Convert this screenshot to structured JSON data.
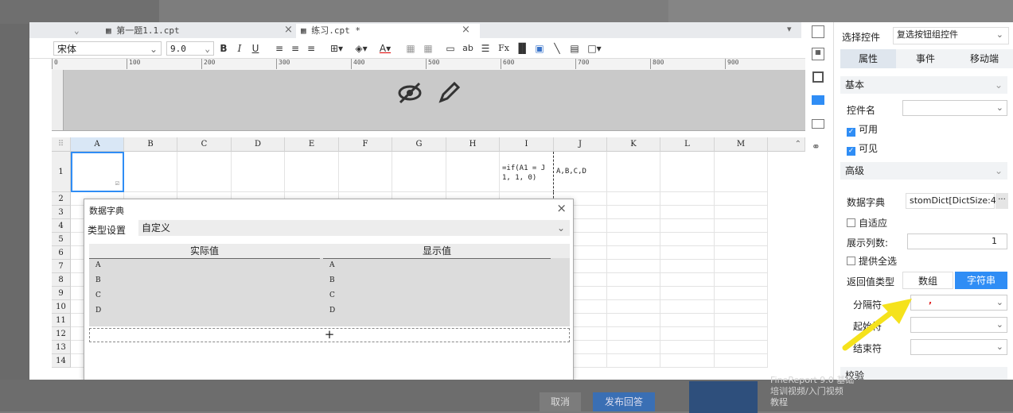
{
  "tabs": [
    {
      "label": "第一题1.1.cpt",
      "active": false
    },
    {
      "label": "练习.cpt *",
      "active": true
    }
  ],
  "format_bar": {
    "font": "宋体",
    "size": "9.0",
    "bold": "B",
    "italic": "I",
    "underline": "U"
  },
  "ruler_ticks": [
    "0",
    "100",
    "200",
    "300",
    "400",
    "500",
    "600",
    "700",
    "800",
    "900"
  ],
  "columns": [
    "A",
    "B",
    "C",
    "D",
    "E",
    "F",
    "G",
    "H",
    "I",
    "J",
    "K",
    "L",
    "M"
  ],
  "rows": [
    "1",
    "2",
    "3",
    "4",
    "5",
    "6",
    "7",
    "8",
    "9",
    "10",
    "11",
    "12",
    "13",
    "14"
  ],
  "cells": {
    "I1_line1": "=if(A1 = J",
    "I1_line2": "1, 1, 0)",
    "J1": "A,B,C,D"
  },
  "dialog": {
    "title": "数据字典",
    "type_label": "类型设置",
    "type_value": "自定义",
    "col_actual": "实际值",
    "col_display": "显示值",
    "rows": [
      {
        "actual": "A",
        "display": "A"
      },
      {
        "actual": "B",
        "display": "B"
      },
      {
        "actual": "C",
        "display": "C"
      },
      {
        "actual": "D",
        "display": "D"
      }
    ],
    "add_symbol": "+"
  },
  "panel": {
    "select_control_label": "选择控件",
    "select_control_value": "复选按钮组控件",
    "tabs": [
      "属性",
      "事件",
      "移动端"
    ],
    "section_basic": "基本",
    "control_name_label": "控件名",
    "enabled": "可用",
    "visible": "可见",
    "section_advanced": "高级",
    "dict_label": "数据字典",
    "dict_value": "stomDict[DictSize:4]",
    "adaptive": "自适应",
    "display_cols_label": "展示列数:",
    "display_cols_value": "1",
    "select_all": "提供全选",
    "return_type_label": "返回值类型",
    "return_type_options": [
      "数组",
      "字符串"
    ],
    "separator_label": "分隔符",
    "separator_value": ",",
    "start_label": "起始符",
    "end_label": "结束符",
    "section_check": "校验"
  },
  "background": {
    "cancel": "取消",
    "publish": "发布回答",
    "promo_line1": "FineReport 9.0 基础",
    "promo_line2": "培训视频/入门视频",
    "promo_line3": "教程"
  },
  "colors": {
    "accent": "#2f8df5",
    "arrow": "#f5e21c",
    "separator": "#e02020"
  }
}
